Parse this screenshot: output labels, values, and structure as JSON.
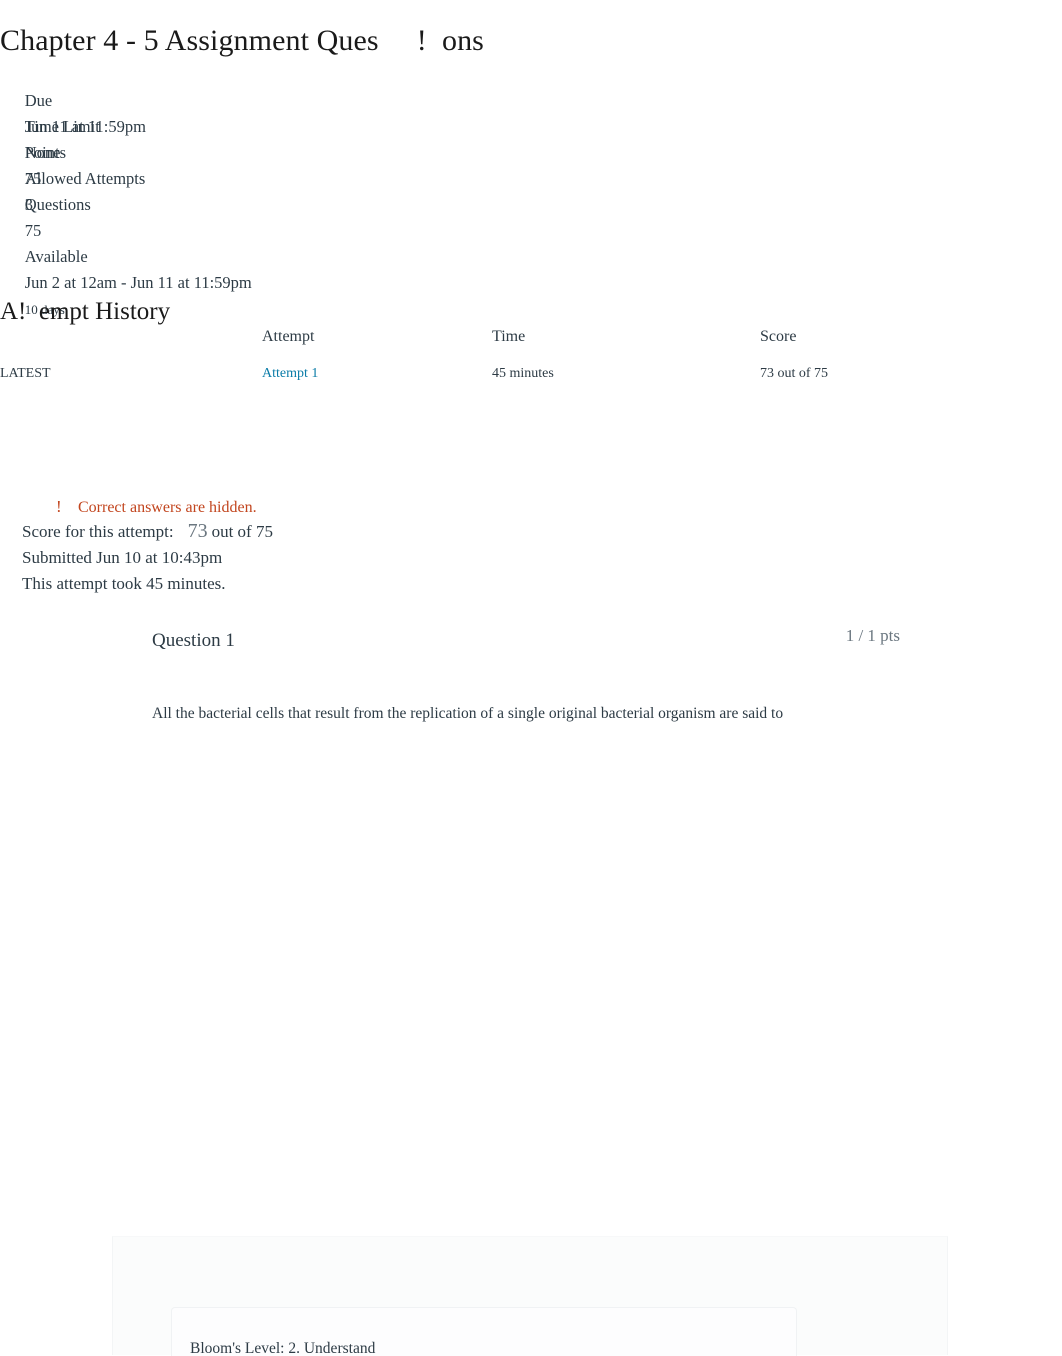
{
  "quiz": {
    "title": "Chapter 4 - 5 Assignment Ques     !  ons",
    "meta": {
      "due_label": "Due",
      "due_value": "Jun 11 at 11:59pm",
      "points_label": "Points",
      "points_value": "75",
      "questions_label": "Questions",
      "questions_value": "75",
      "available_label": "Available",
      "available_value": "Jun 2 at 12am - Jun 11 at 11:59pm",
      "available_duration": "10 days",
      "time_limit_label": "Time Limit",
      "time_limit_value": "None",
      "allowed_attempts_label": "Allowed Attempts",
      "allowed_attempts_value": "3"
    }
  },
  "attempt_history": {
    "heading": "A!  empt History",
    "columns": {
      "kept": "",
      "attempt": "Attempt",
      "time": "Time",
      "score": "Score"
    },
    "rows": [
      {
        "kept": "LATEST",
        "attempt": "Attempt 1",
        "time": "45 minutes",
        "score": "73 out of 75"
      }
    ]
  },
  "notice": {
    "icon": "!",
    "text": "Correct answers are hidden.",
    "color": "#c2451e"
  },
  "attempt_summary": {
    "score_label": "Score for this attempt:",
    "score_value": "73",
    "score_suffix": "out of 75",
    "submitted": "Submitted Jun 10 at 10:43pm",
    "duration": "This attempt took 45 minutes."
  },
  "question": {
    "name": "Question 1",
    "points": "1 / 1 pts",
    "text": "All the bacterial cells that result from the replication of a single original bacterial organism are said to",
    "feedback": {
      "blooms_level": "Bloom's Level: 2. Understand"
    }
  },
  "colors": {
    "link": "#0b7ca8",
    "warning": "#c2451e",
    "text": "#2d3b45",
    "muted": "#6b7780"
  }
}
